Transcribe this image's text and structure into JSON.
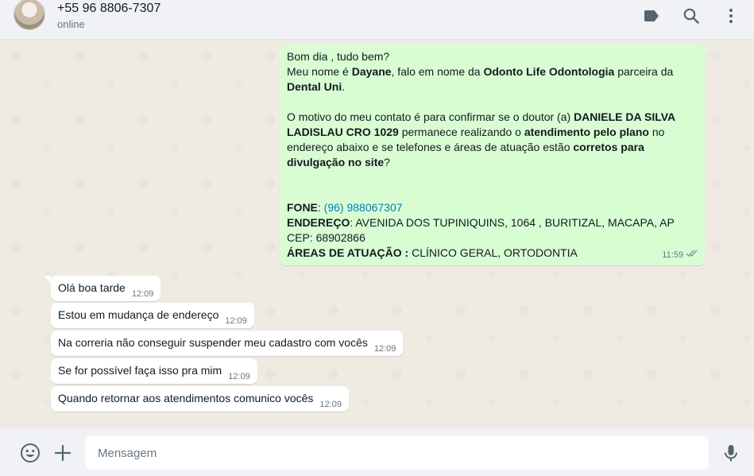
{
  "header": {
    "contact_name": "+55 96 8806-7307",
    "status": "online",
    "icons": [
      "label-icon",
      "search-icon",
      "menu-icon"
    ]
  },
  "outgoing": {
    "greeting": "Bom dia  , tudo bem?",
    "intro_prefix": "Meu nome é ",
    "name": "Dayane",
    "intro_mid": ", falo em nome da ",
    "clinic": "Odonto Life Odontologia",
    "intro_mid2": " parceira da ",
    "partner": "Dental Uni",
    "intro_end": ".",
    "motive_prefix": "O motivo do meu contato é para confirmar se o doutor (a) ",
    "doctor": "DANIELE DA SILVA LADISLAU  CRO 1029",
    "motive_mid": " permanece realizando o ",
    "attendance": "atendimento pelo plano",
    "motive_mid2": " no endereço abaixo e se telefones e áreas de atuação estão ",
    "correct": "corretos para divulgação no site",
    "motive_end": "?",
    "phone_label": "FONE",
    "phone_sep": ": ",
    "phone_value": "(96) 988067307",
    "address_label": "ENDEREÇO",
    "address_value": ": AVENIDA DOS TUPINIQUINS, 1064 , BURITIZAL, MACAPA, AP CEP: 68902866",
    "areas_label": "ÁREAS DE ATUAÇÃO :",
    "areas_value": " CLÍNICO GERAL, ORTODONTIA",
    "time": "11:59",
    "status_icon": "double-check-icon"
  },
  "incoming": [
    {
      "text": "Olá boa tarde",
      "time": "12:09"
    },
    {
      "text": "Estou em mudança de endereço",
      "time": "12:09"
    },
    {
      "text": "Na correria não conseguir suspender meu cadastro com vocês",
      "time": "12:09"
    },
    {
      "text": "Se for possível faça isso pra mim",
      "time": "12:09"
    },
    {
      "text": "Quando retornar aos atendimentos comunico vocês",
      "time": "12:09"
    }
  ],
  "footer": {
    "placeholder": "Mensagem",
    "icons": [
      "emoji-icon",
      "plus-icon",
      "mic-icon"
    ]
  },
  "colors": {
    "outgoing_bubble": "#d9fdd3",
    "incoming_bubble": "#ffffff",
    "chat_background": "#efeae2",
    "header_background": "#f0f2f5",
    "link": "#027eb5",
    "read_ticks": "#8696a0"
  }
}
